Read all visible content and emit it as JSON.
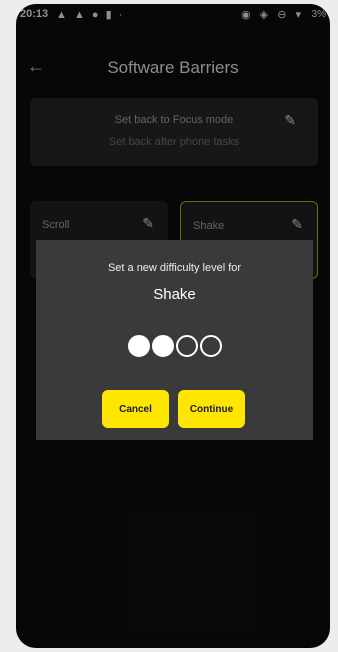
{
  "status_bar": {
    "time": "20:13",
    "left_icons": "▲ ▲ ● ▮ ·",
    "right_icons": "◉ ◈ ⊖ ▾",
    "battery": "3%"
  },
  "app_bar": {
    "title": "Software Barriers",
    "back_icon": "arrow-left-icon"
  },
  "focus_card": {
    "title": "Set back to Focus mode",
    "subtitle": "Set back after phone tasks",
    "edit_icon": "pencil-icon"
  },
  "barriers": [
    {
      "label": "Scroll",
      "selected": false
    },
    {
      "label": "Shake",
      "selected": true
    }
  ],
  "dialog": {
    "heading": "Set a new difficulty level for",
    "barrier_name": "Shake",
    "difficulty_level": 2,
    "difficulty_max": 4,
    "cancel_label": "Cancel",
    "continue_label": "Continue"
  },
  "colors": {
    "accent": "#ffe600",
    "selected_border": "#b8a300",
    "background": "#0c0c0c",
    "dialog": "#3a3a3a"
  }
}
